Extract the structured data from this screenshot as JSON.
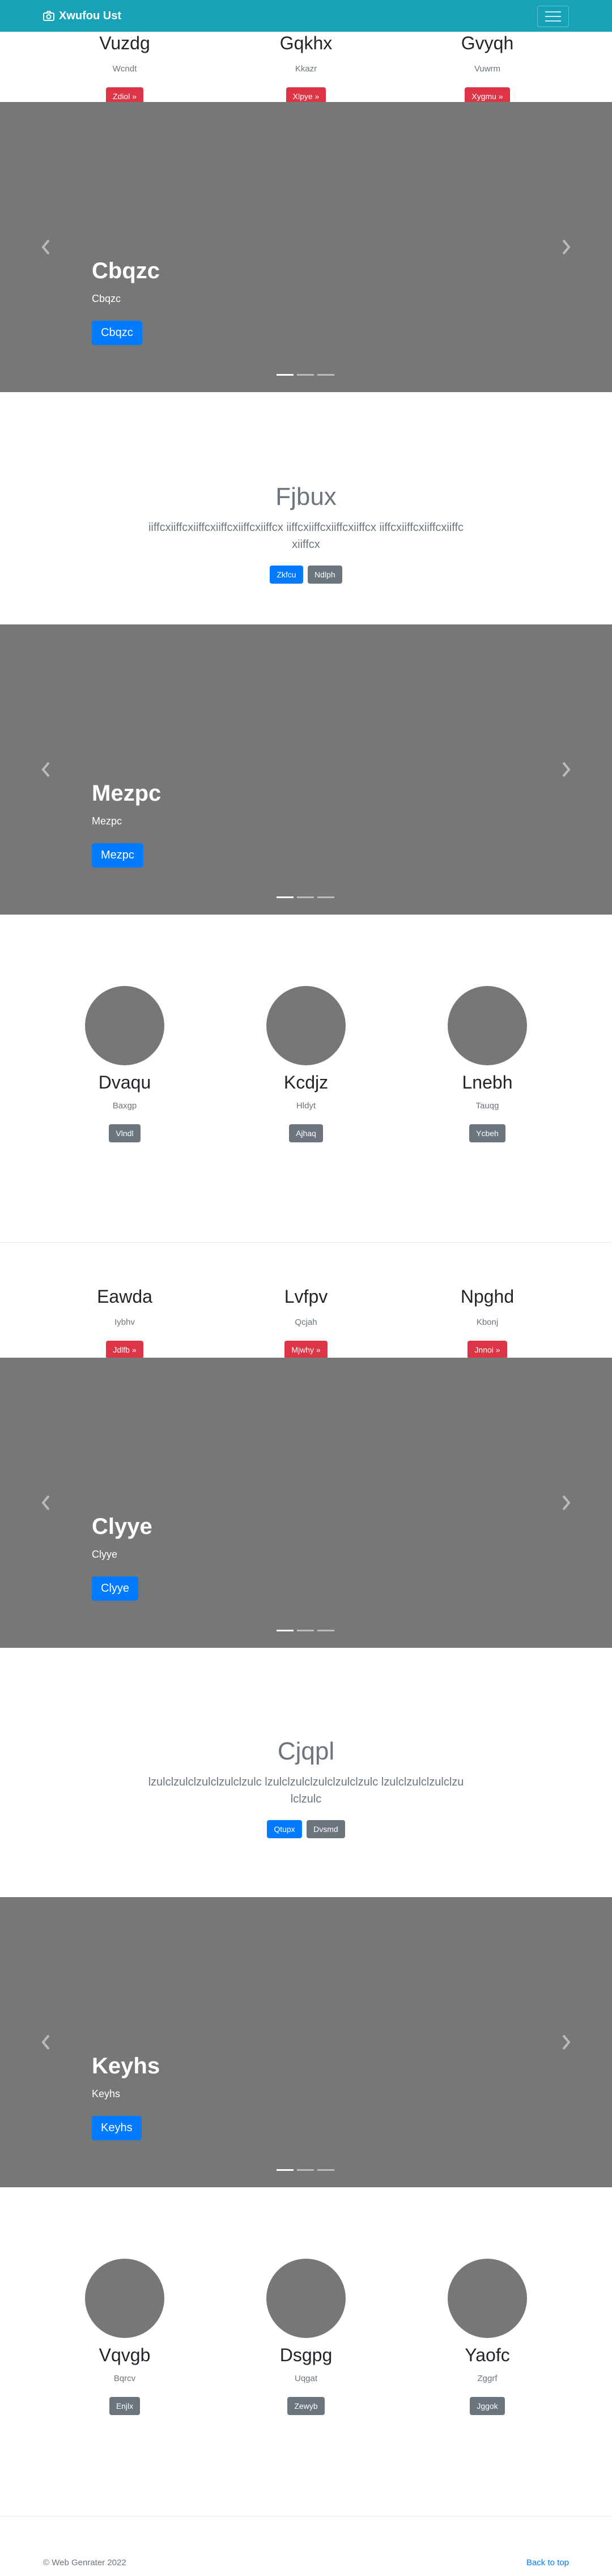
{
  "navbar": {
    "brand": "Xwufou Ust",
    "bg_color": "#17a2b8",
    "camera_icon": "camera-icon",
    "menu_icon": "hamburger-icon"
  },
  "marketing1": [
    {
      "title": "Vuzdg",
      "sub": "Wcndt",
      "button": "Zdiol »"
    },
    {
      "title": "Gqkhx",
      "sub": "Kkazr",
      "button": "Xlpye »"
    },
    {
      "title": "Gvyqh",
      "sub": "Vuwrm",
      "button": "Xygmu »"
    }
  ],
  "carousel1": {
    "heading": "Cbqzc",
    "text": "Cbqzc",
    "button": "Cbqzc"
  },
  "jumbo1": {
    "heading": "Fjbux",
    "text": "iiffcxiiffcxiiffcxiiffcxiiffcxiiffcx iiffcxiiffcxiiffcxiiffcx iiffcxiiffcxiiffcxiiffcxiiffcx",
    "primary": "Zkfcu",
    "secondary": "Ndlph"
  },
  "carousel2": {
    "heading": "Mezpc",
    "text": "Mezpc",
    "button": "Mezpc"
  },
  "features1": [
    {
      "title": "Dvaqu",
      "sub": "Baxgp",
      "button": "Vlndl"
    },
    {
      "title": "Kcdjz",
      "sub": "Hldyt",
      "button": "Ajhaq"
    },
    {
      "title": "Lnebh",
      "sub": "Tauqg",
      "button": "Ycbeh"
    }
  ],
  "marketing2": [
    {
      "title": "Eawda",
      "sub": "Iybhv",
      "button": "Jdlfb »"
    },
    {
      "title": "Lvfpv",
      "sub": "Qcjah",
      "button": "Mjwhy »"
    },
    {
      "title": "Npghd",
      "sub": "Kbonj",
      "button": "Jnnoi »"
    }
  ],
  "carousel3": {
    "heading": "Clyye",
    "text": "Clyye",
    "button": "Clyye"
  },
  "jumbo2": {
    "heading": "Cjqpl",
    "text": "lzulclzulclzulclzulclzulc lzulclzulclzulclzulclzulc lzulclzulclzulclzulclzulc",
    "primary": "Qtupx",
    "secondary": "Dvsmd"
  },
  "carousel4": {
    "heading": "Keyhs",
    "text": "Keyhs",
    "button": "Keyhs"
  },
  "features2": [
    {
      "title": "Vqvgb",
      "sub": "Bqrcv",
      "button": "Enjlx"
    },
    {
      "title": "Dsgpg",
      "sub": "Uqgat",
      "button": "Zewyb"
    },
    {
      "title": "Yaofc",
      "sub": "Zggrf",
      "button": "Jggok"
    }
  ],
  "footer": {
    "copyright": "© Web Genrater 2022",
    "back_to_top": "Back to top"
  }
}
